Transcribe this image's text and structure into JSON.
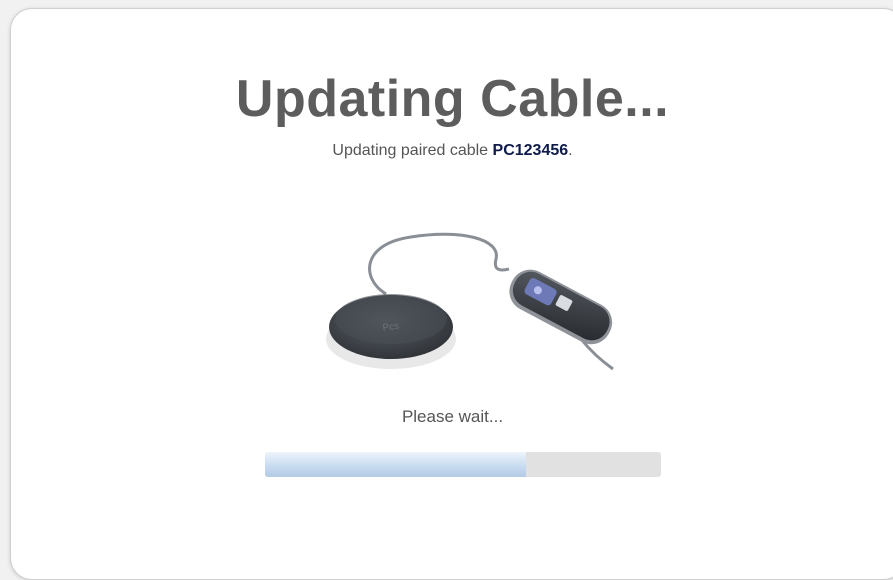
{
  "title": "Updating Cable...",
  "subtitle": {
    "prefix": "Updating paired cable ",
    "serial": "PC123456",
    "suffix": "."
  },
  "status_text": "Please wait...",
  "progress": {
    "fraction": 0.66
  },
  "device_image": {
    "icon": "pairing-cable-device",
    "brand_mark": "Pcs"
  },
  "colors": {
    "title": "#5d5d5d",
    "serial": "#0d1a4a",
    "progress_fill": "#c9dcf1",
    "progress_track": "#e1e1e1"
  }
}
